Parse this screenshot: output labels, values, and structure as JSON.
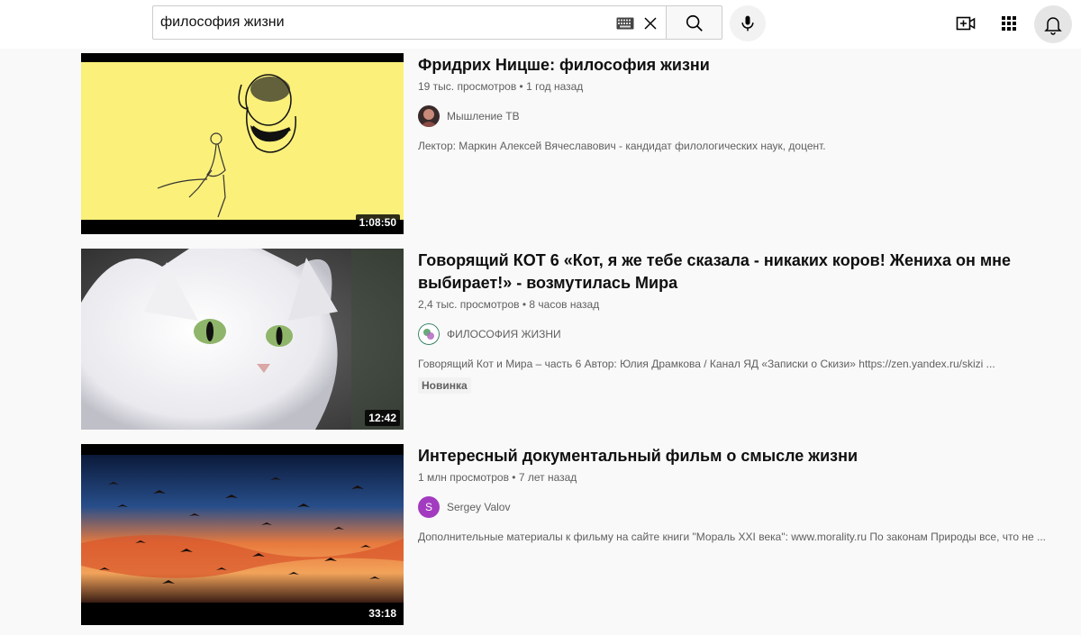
{
  "search": {
    "query": "философия жизни"
  },
  "icons": {
    "keyboard": "keyboard-icon",
    "clear": "close-icon",
    "search": "search-icon",
    "mic": "mic-icon",
    "create": "create-video-icon",
    "apps": "apps-grid-icon",
    "notifications": "bell-icon"
  },
  "results": [
    {
      "title": "Фридрих Ницше: философия жизни",
      "views": "19 тыс. просмотров",
      "age": "1 год назад",
      "channel": "Мышление ТВ",
      "description": "Лектор: Маркин Алексей Вячеславович - кандидат филологических наук, доцент.",
      "duration": "1:08:50"
    },
    {
      "title": "Говорящий КОТ 6 «Кот, я же тебе сказала - никаких коров! Жениха он мне выбирает!» - возмутилась Мира",
      "views": "2,4 тыс. просмотров",
      "age": "8 часов назад",
      "channel": "ФИЛОСОФИЯ ЖИЗНИ",
      "description": "Говорящий Кот и Мира – часть 6 Автор: Юлия Драмкова / Канал ЯД «Записки о Скизи» https://zen.yandex.ru/skizi ...",
      "badge": "Новинка",
      "duration": "12:42"
    },
    {
      "title": "Интересный документальный фильм о смысле жизни",
      "views": "1 млн просмотров",
      "age": "7 лет назад",
      "channel": "Sergey Valov",
      "avatar_letter": "S",
      "description": "Дополнительные материалы к фильму на сайте книги \"Мораль XXI века\": www.morality.ru По законам Природы все, что не ...",
      "duration": "33:18"
    }
  ],
  "meta_separator": "•",
  "colors": {
    "accent_avatar_s": "#a23bbf",
    "thumb1_bg": "#fbf07a"
  }
}
